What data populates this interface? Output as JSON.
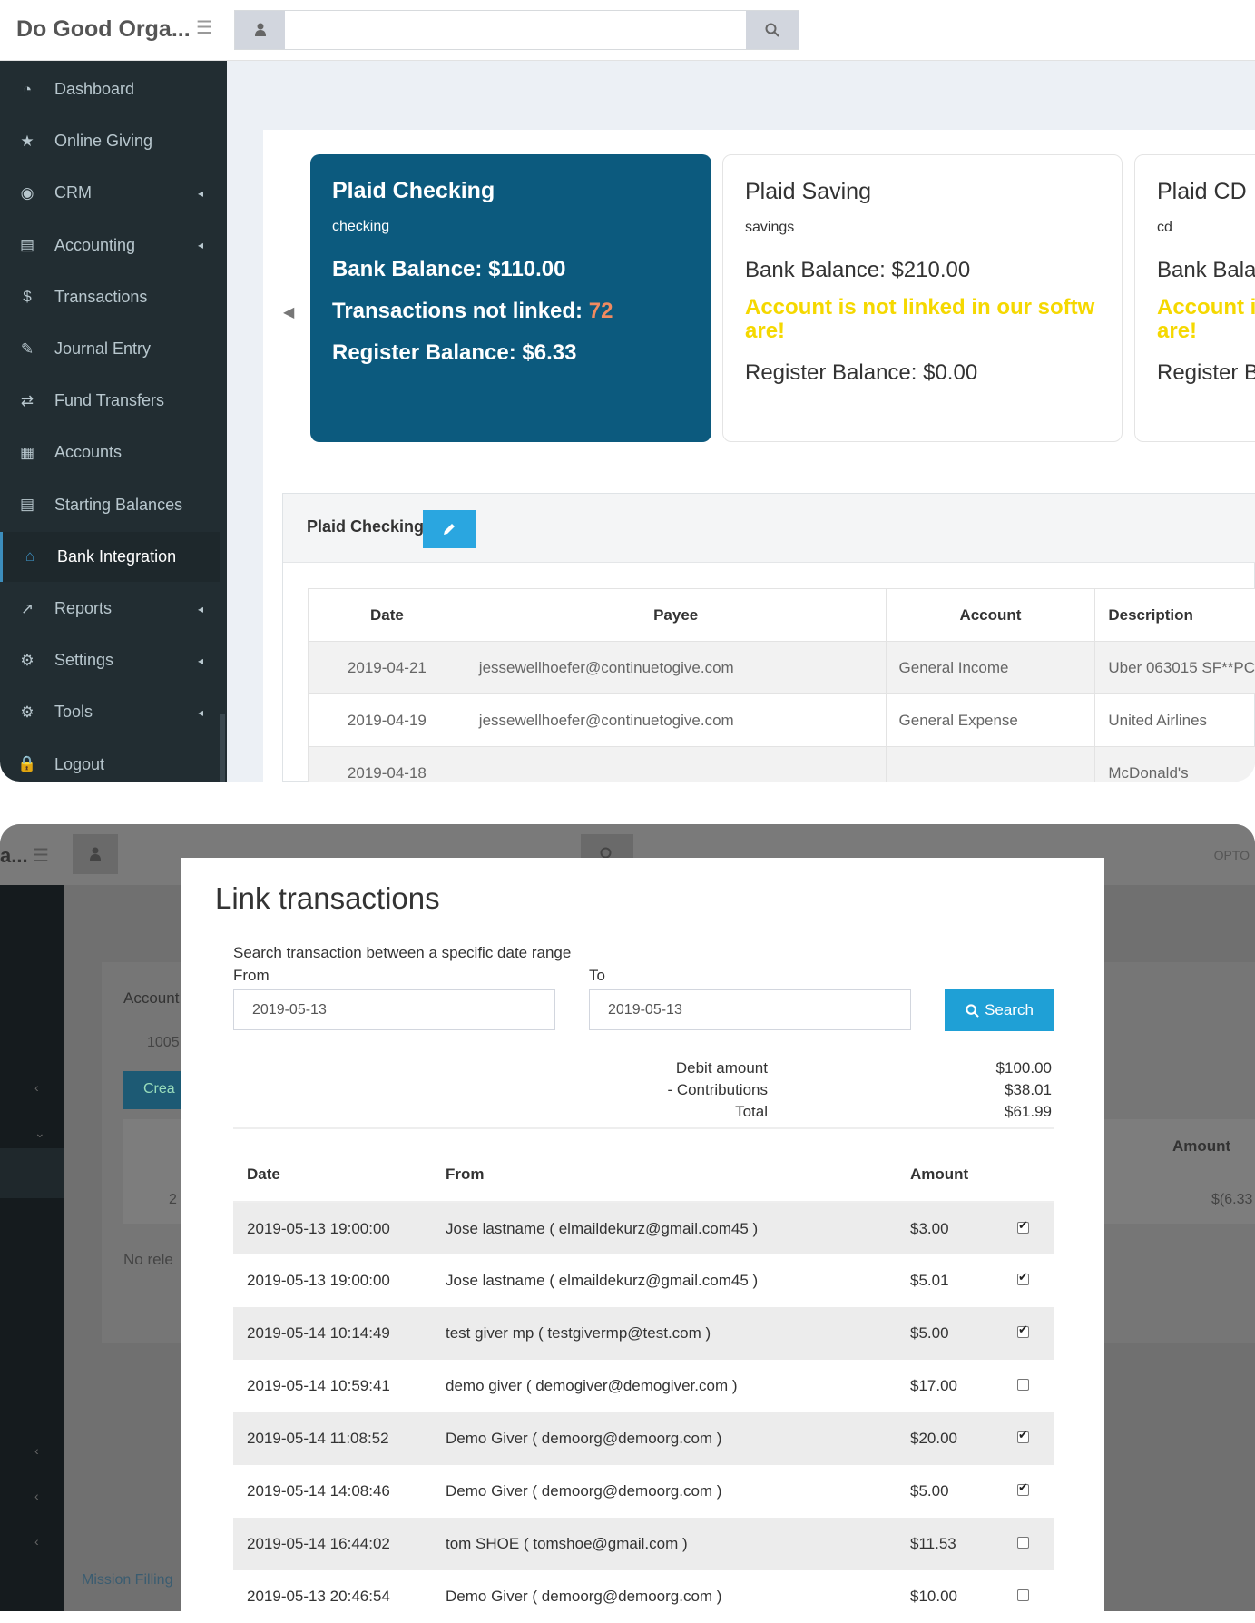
{
  "top": {
    "brand": "Do Good Orga...",
    "search_placeholder": "",
    "sidebar": [
      {
        "icon": "dashboard-icon",
        "glyph": "◔",
        "label": "Dashboard",
        "chevron": false,
        "active": false
      },
      {
        "icon": "star-icon",
        "glyph": "★",
        "label": "Online Giving",
        "chevron": false,
        "active": false
      },
      {
        "icon": "crm-icon",
        "glyph": "◉",
        "label": "CRM",
        "chevron": true,
        "active": false
      },
      {
        "icon": "accounting-icon",
        "glyph": "▤",
        "label": "Accounting",
        "chevron": true,
        "active": false
      },
      {
        "icon": "dollar-icon",
        "glyph": "$",
        "label": "Transactions",
        "chevron": false,
        "active": false
      },
      {
        "icon": "journal-icon",
        "glyph": "✎",
        "label": "Journal Entry",
        "chevron": false,
        "active": false
      },
      {
        "icon": "transfer-icon",
        "glyph": "⇄",
        "label": "Fund Transfers",
        "chevron": false,
        "active": false
      },
      {
        "icon": "accounts-icon",
        "glyph": "▦",
        "label": "Accounts",
        "chevron": false,
        "active": false
      },
      {
        "icon": "balance-icon",
        "glyph": "▤",
        "label": "Starting Balances",
        "chevron": false,
        "active": false
      },
      {
        "icon": "bank-icon",
        "glyph": "⌂",
        "label": "Bank Integration",
        "chevron": false,
        "active": true
      },
      {
        "icon": "reports-icon",
        "glyph": "↗",
        "label": "Reports",
        "chevron": true,
        "active": false
      },
      {
        "icon": "settings-icon",
        "glyph": "⚙",
        "label": "Settings",
        "chevron": true,
        "active": false
      },
      {
        "icon": "tools-icon",
        "glyph": "⚙",
        "label": "Tools",
        "chevron": true,
        "active": false
      },
      {
        "icon": "lock-icon",
        "glyph": "🔒",
        "label": "Logout",
        "chevron": false,
        "active": false
      }
    ],
    "cards": {
      "checking": {
        "title": "Plaid Checking",
        "type": "checking",
        "bank": "Bank Balance: $110.00",
        "tx_label": "Transactions not linked: ",
        "tx_count": "72",
        "register": "Register Balance: $6.33"
      },
      "saving": {
        "title": "Plaid Saving",
        "type": "savings",
        "bank": "Bank Balance: $210.00",
        "warn": "Account is not linked in our softw are!",
        "register": "Register Balance: $0.00"
      },
      "cd": {
        "title": "Plaid CD",
        "type": "cd",
        "bank": "Bank Bala",
        "warn": "Account i are!",
        "register": "Register B"
      }
    },
    "ledger": {
      "title": "Plaid Checking",
      "headers": [
        "Date",
        "Payee",
        "Account",
        "Description"
      ],
      "rows": [
        {
          "date": "2019-04-21",
          "payee": "jessewellhoefer@continuetogive.com",
          "account": "General Income",
          "desc": "Uber 063015 SF**PC"
        },
        {
          "date": "2019-04-19",
          "payee": "jessewellhoefer@continuetogive.com",
          "account": "General Expense",
          "desc": "United Airlines"
        },
        {
          "date": "2019-04-18",
          "payee": "",
          "account": "",
          "desc": "McDonald's"
        }
      ]
    }
  },
  "bottom": {
    "bg": {
      "brand": "a...",
      "right_text": "OPTO",
      "account_label": "Account",
      "account_value": "1005",
      "create_label": "Crea",
      "amount_head": "Amount",
      "amount_val": "$(6.33",
      "row_prefix": "2",
      "no_rel": "No rele",
      "mission": "Mission Filling"
    },
    "modal": {
      "title": "Link transactions",
      "hint": "Search transaction between a specific date range",
      "from_label": "From",
      "to_label": "To",
      "from_value": "2019-05-13",
      "to_value": "2019-05-13",
      "search_label": "Search",
      "summary": [
        {
          "label": "Debit amount",
          "value": "$100.00"
        },
        {
          "label": "- Contributions",
          "value": "$38.01"
        },
        {
          "label": "Total",
          "value": "$61.99"
        }
      ],
      "headers": [
        "Date",
        "From",
        "Amount"
      ],
      "rows": [
        {
          "date": "2019-05-13 19:00:00",
          "from": "Jose lastname ( elmaildekurz@gmail.com45 )",
          "amount": "$3.00",
          "checked": true
        },
        {
          "date": "2019-05-13 19:00:00",
          "from": "Jose lastname ( elmaildekurz@gmail.com45 )",
          "amount": "$5.01",
          "checked": true
        },
        {
          "date": "2019-05-14 10:14:49",
          "from": "test giver mp ( testgivermp@test.com )",
          "amount": "$5.00",
          "checked": true
        },
        {
          "date": "2019-05-14 10:59:41",
          "from": "demo giver ( demogiver@demogiver.com )",
          "amount": "$17.00",
          "checked": false
        },
        {
          "date": "2019-05-14 11:08:52",
          "from": "Demo Giver ( demoorg@demoorg.com )",
          "amount": "$20.00",
          "checked": true
        },
        {
          "date": "2019-05-14 14:08:46",
          "from": "Demo Giver ( demoorg@demoorg.com )",
          "amount": "$5.00",
          "checked": true
        },
        {
          "date": "2019-05-14 16:44:02",
          "from": "tom SHOE ( tomshoe@gmail.com )",
          "amount": "$11.53",
          "checked": false
        },
        {
          "date": "2019-05-13 20:46:54",
          "from": "Demo Giver ( demoorg@demoorg.com )",
          "amount": "$10.00",
          "checked": false
        }
      ]
    }
  },
  "colors": {
    "card_active": "#0c5a7e",
    "sidebar": "#222d32",
    "accent": "#1fa0d6",
    "warn": "#f5d800",
    "count": "#f08a60"
  }
}
